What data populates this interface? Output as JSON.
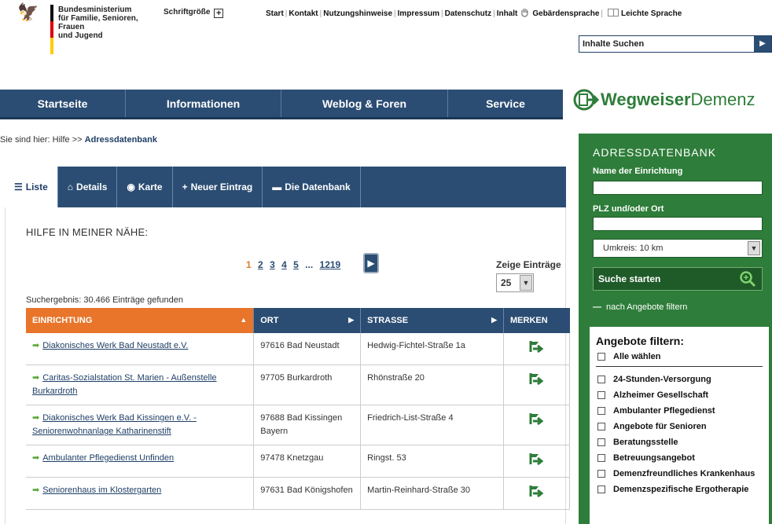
{
  "header": {
    "ministry": [
      "Bundesministerium",
      "für Familie, Senioren, Frauen",
      "und Jugend"
    ],
    "fontsize_label": "Schriftgröße",
    "fontsize_btn": "+",
    "nav": [
      "Start",
      "Kontakt",
      "Nutzungshinweise",
      "Impressum",
      "Datenschutz",
      "Inhalt"
    ],
    "sign_language": "Gebärdensprache",
    "easy_language": "Leichte Sprache",
    "search_placeholder": "Inhalte Suchen",
    "search_btn": "▶"
  },
  "mainnav": [
    "Startseite",
    "Informationen",
    "Weblog & Foren",
    "Service"
  ],
  "brand": {
    "strong": "Wegweiser",
    "light": "Demenz"
  },
  "breadcrumb": {
    "prefix": "Sie sind hier:",
    "hilfe": "Hilfe",
    "sep": ">>",
    "current": "Adressdatenbank"
  },
  "tabs": [
    {
      "label": "Liste",
      "icon": "☰"
    },
    {
      "label": "Details",
      "icon": "⌂"
    },
    {
      "label": "Karte",
      "icon": "◉"
    },
    {
      "label": "Neuer Eintrag",
      "icon": "+"
    },
    {
      "label": "Die Datenbank",
      "icon": "▬"
    }
  ],
  "main": {
    "title": "HILFE IN MEINER NÄHE:",
    "pager": {
      "current": "1",
      "pages": [
        "2",
        "3",
        "4",
        "5"
      ],
      "dots": "...",
      "last": "1219",
      "next": "▶"
    },
    "show_label": "Zeige Einträge",
    "show_value": "25",
    "result": "Suchergebnis: 30.466 Einträge gefunden"
  },
  "table": {
    "headers": {
      "einrichtung": "EINRICHTUNG",
      "ort": "ORT",
      "strasse": "STRASSE",
      "merken": "MERKEN"
    },
    "rows": [
      {
        "name": "Diakonisches Werk Bad Neustadt e.V.",
        "ort": "97616 Bad Neustadt",
        "strasse": "Hedwig-Fichtel-Straße 1a"
      },
      {
        "name": "Caritas-Sozialstation St. Marien - Außenstelle Burkardroth",
        "ort": "97705 Burkardroth",
        "strasse": "Rhönstraße 20"
      },
      {
        "name": "Diakonisches Werk Bad Kissingen e.V. - Seniorenwohnanlage Katharinenstift",
        "ort": "97688 Bad Kissingen Bayern",
        "strasse": "Friedrich-List-Straße 4"
      },
      {
        "name": "Ambulanter Pflegedienst Unfinden",
        "ort": "97478 Knetzgau",
        "strasse": "Ringst. 53"
      },
      {
        "name": "Seniorenhaus im Klostergarten",
        "ort": "97631 Bad Königshofen",
        "strasse": "Martin-Reinhard-Straße 30"
      }
    ]
  },
  "sidebar": {
    "title": "ADRESSDATENBANK",
    "name_label": "Name der Einrichtung",
    "plz_label": "PLZ und/oder Ort",
    "radius": "Umkreis: 10 km",
    "search_btn": "Suche starten",
    "filter_link": "nach Angebote filtern",
    "filter_title": "Angebote filtern:",
    "select_all": "Alle wählen",
    "filters": [
      "24-Stunden-Versorgung",
      "Alzheimer Gesellschaft",
      "Ambulanter Pflegedienst",
      "Angebote für Senioren",
      "Beratungsstelle",
      "Betreuungsangebot",
      "Demenzfreundliches Krankenhaus",
      "Demenzspezifische Ergotherapie"
    ]
  },
  "colors": {
    "navy": "#2b4d73",
    "orange": "#e8752a",
    "green": "#2e7d3a"
  }
}
